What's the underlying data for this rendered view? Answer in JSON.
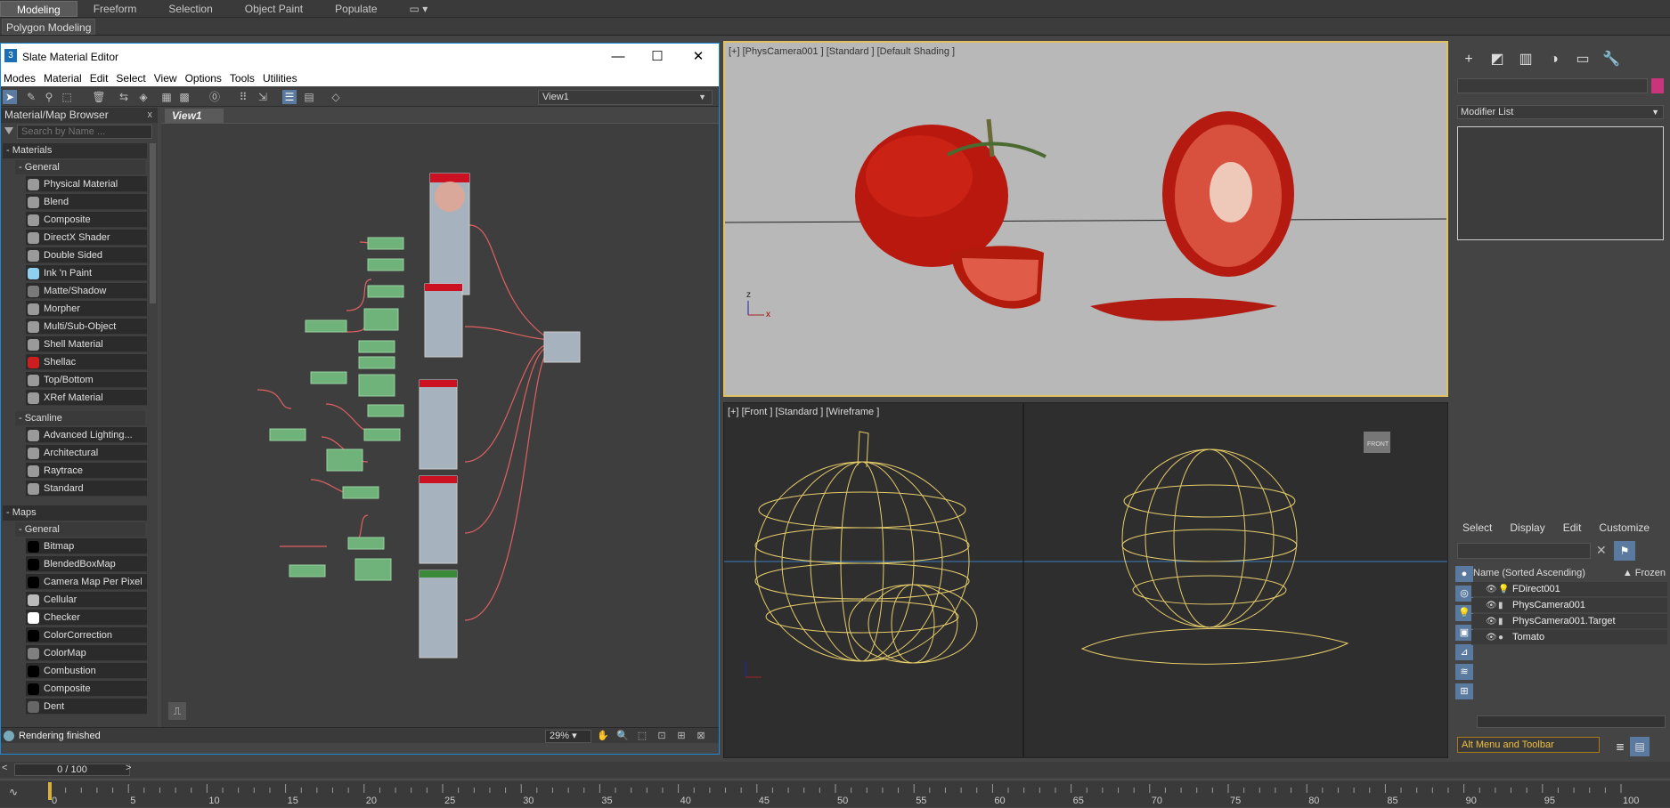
{
  "ribbon": {
    "tabs": [
      "Modeling",
      "Freeform",
      "Selection",
      "Object Paint",
      "Populate"
    ],
    "active_tab": "Modeling",
    "sub_button": "Polygon Modeling"
  },
  "slate": {
    "title": "Slate Material Editor",
    "menu": [
      "Modes",
      "Material",
      "Edit",
      "Select",
      "View",
      "Options",
      "Tools",
      "Utilities"
    ],
    "view_select": "View1",
    "view_tab": "View1",
    "browser": {
      "title": "Material/Map Browser",
      "search_placeholder": "Search by Name ...",
      "groups": [
        {
          "label": "- Materials",
          "subgroups": [
            {
              "label": "- General",
              "items": [
                {
                  "label": "Physical Material",
                  "swatch": "#9a9a9a"
                },
                {
                  "label": "Blend",
                  "swatch": "#9a9a9a"
                },
                {
                  "label": "Composite",
                  "swatch": "#9a9a9a"
                },
                {
                  "label": "DirectX Shader",
                  "swatch": "#9a9a9a"
                },
                {
                  "label": "Double Sided",
                  "swatch": "#9a9a9a"
                },
                {
                  "label": "Ink 'n Paint",
                  "swatch": "#8fd0f0"
                },
                {
                  "label": "Matte/Shadow",
                  "swatch": "#7a7a7a"
                },
                {
                  "label": "Morpher",
                  "swatch": "#9a9a9a"
                },
                {
                  "label": "Multi/Sub-Object",
                  "swatch": "#9a9a9a"
                },
                {
                  "label": "Shell Material",
                  "swatch": "#9a9a9a"
                },
                {
                  "label": "Shellac",
                  "swatch": "#cc1e1e"
                },
                {
                  "label": "Top/Bottom",
                  "swatch": "#9a9a9a"
                },
                {
                  "label": "XRef Material",
                  "swatch": "#9a9a9a"
                }
              ]
            },
            {
              "label": "- Scanline",
              "items": [
                {
                  "label": "Advanced Lighting...",
                  "swatch": "#9a9a9a"
                },
                {
                  "label": "Architectural",
                  "swatch": "#9a9a9a"
                },
                {
                  "label": "Raytrace",
                  "swatch": "#9a9a9a"
                },
                {
                  "label": "Standard",
                  "swatch": "#9a9a9a"
                }
              ]
            }
          ]
        },
        {
          "label": "- Maps",
          "subgroups": [
            {
              "label": "- General",
              "items": [
                {
                  "label": "Bitmap",
                  "swatch": "#000000"
                },
                {
                  "label": "BlendedBoxMap",
                  "swatch": "#000000"
                },
                {
                  "label": "Camera Map Per Pixel",
                  "swatch": "#000000"
                },
                {
                  "label": "Cellular",
                  "swatch": "#bbbbbb"
                },
                {
                  "label": "Checker",
                  "swatch": "#ffffff"
                },
                {
                  "label": "ColorCorrection",
                  "swatch": "#000000"
                },
                {
                  "label": "ColorMap",
                  "swatch": "#808080"
                },
                {
                  "label": "Combustion",
                  "swatch": "#000000"
                },
                {
                  "label": "Composite",
                  "swatch": "#000000"
                },
                {
                  "label": "Dent",
                  "swatch": "#666666"
                }
              ]
            }
          ]
        }
      ]
    },
    "status_text": "Rendering finished",
    "zoom": "29%"
  },
  "viewports": {
    "top_label": "[+] [PhysCamera001 ] [Standard ] [Default Shading ]",
    "bottom_label": "[+] [Front ] [Standard ] [Wireframe ]",
    "front_cube_label": "FRONT",
    "axis_x": "x",
    "axis_z": "z"
  },
  "command_panel": {
    "modifier_list": "Modifier List",
    "scene_tabs": [
      "Select",
      "Display",
      "Edit",
      "Customize"
    ],
    "col_name": "Name (Sorted Ascending)",
    "col_frozen": "▲ Frozen",
    "objects": [
      {
        "name": "FDirect001",
        "kind": "light"
      },
      {
        "name": "PhysCamera001",
        "kind": "camera"
      },
      {
        "name": "PhysCamera001.Target",
        "kind": "camera"
      },
      {
        "name": "Tomato",
        "kind": "geometry"
      }
    ],
    "alt_menu": "Alt Menu and Toolbar"
  },
  "timeline": {
    "slider": "0 / 100",
    "ticks": [
      "0",
      "5",
      "10",
      "15",
      "20",
      "25",
      "30",
      "35",
      "40",
      "45",
      "50",
      "55",
      "60",
      "65",
      "70",
      "75",
      "80",
      "85",
      "90",
      "95",
      "100"
    ],
    "current_frame": 0
  }
}
